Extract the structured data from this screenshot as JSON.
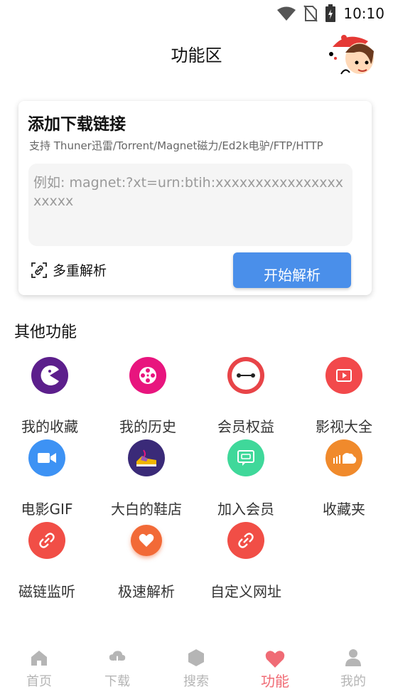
{
  "status_bar": {
    "time": "10:10"
  },
  "header": {
    "title": "功能区"
  },
  "card": {
    "title": "添加下载链接",
    "subtitle": "支持 Thuner迅雷/Torrent/Magnet磁力/Ed2k电驴/FTP/HTTP",
    "input_placeholder": "例如: magnet:?xt=urn:btih:xxxxxxxxxxxxxxxxxxxxx",
    "multi_parse_label": "多重解析",
    "start_button_label": "开始解析"
  },
  "section": {
    "title": "其他功能"
  },
  "features": [
    {
      "label": "我的收藏",
      "icon": "pacman-icon",
      "color": "#5c1f8c"
    },
    {
      "label": "我的历史",
      "icon": "film-reel-icon",
      "color": "#e8157e"
    },
    {
      "label": "会员权益",
      "icon": "baymax-icon",
      "color": "#e84448"
    },
    {
      "label": "影视大全",
      "icon": "video-icon",
      "color": "#f2494b"
    },
    {
      "label": "电影GIF",
      "icon": "camera-icon",
      "color": "#3d92f4"
    },
    {
      "label": "大白的鞋店",
      "icon": "shoe-icon",
      "color": "#3a2a78"
    },
    {
      "label": "加入会员",
      "icon": "member-card-icon",
      "color": "#3fd89a"
    },
    {
      "label": "收藏夹",
      "icon": "soundcloud-icon",
      "color": "#f08a2c"
    },
    {
      "label": "磁链监听",
      "icon": "link-icon",
      "color": "#f14e46"
    },
    {
      "label": "极速解析",
      "icon": "heart-icon",
      "color": "#f26a37"
    },
    {
      "label": "自定义网址",
      "icon": "link-icon",
      "color": "#f14e46"
    }
  ],
  "tabbar": {
    "items": [
      {
        "label": "首页",
        "icon": "home-icon",
        "active": false
      },
      {
        "label": "下载",
        "icon": "cloud-download-icon",
        "active": false
      },
      {
        "label": "搜索",
        "icon": "hexagon-icon",
        "active": false
      },
      {
        "label": "功能",
        "icon": "heart-icon",
        "active": true
      },
      {
        "label": "我的",
        "icon": "user-icon",
        "active": false
      }
    ],
    "active_color": "#f06b75",
    "inactive_color": "#b5b5b5"
  }
}
